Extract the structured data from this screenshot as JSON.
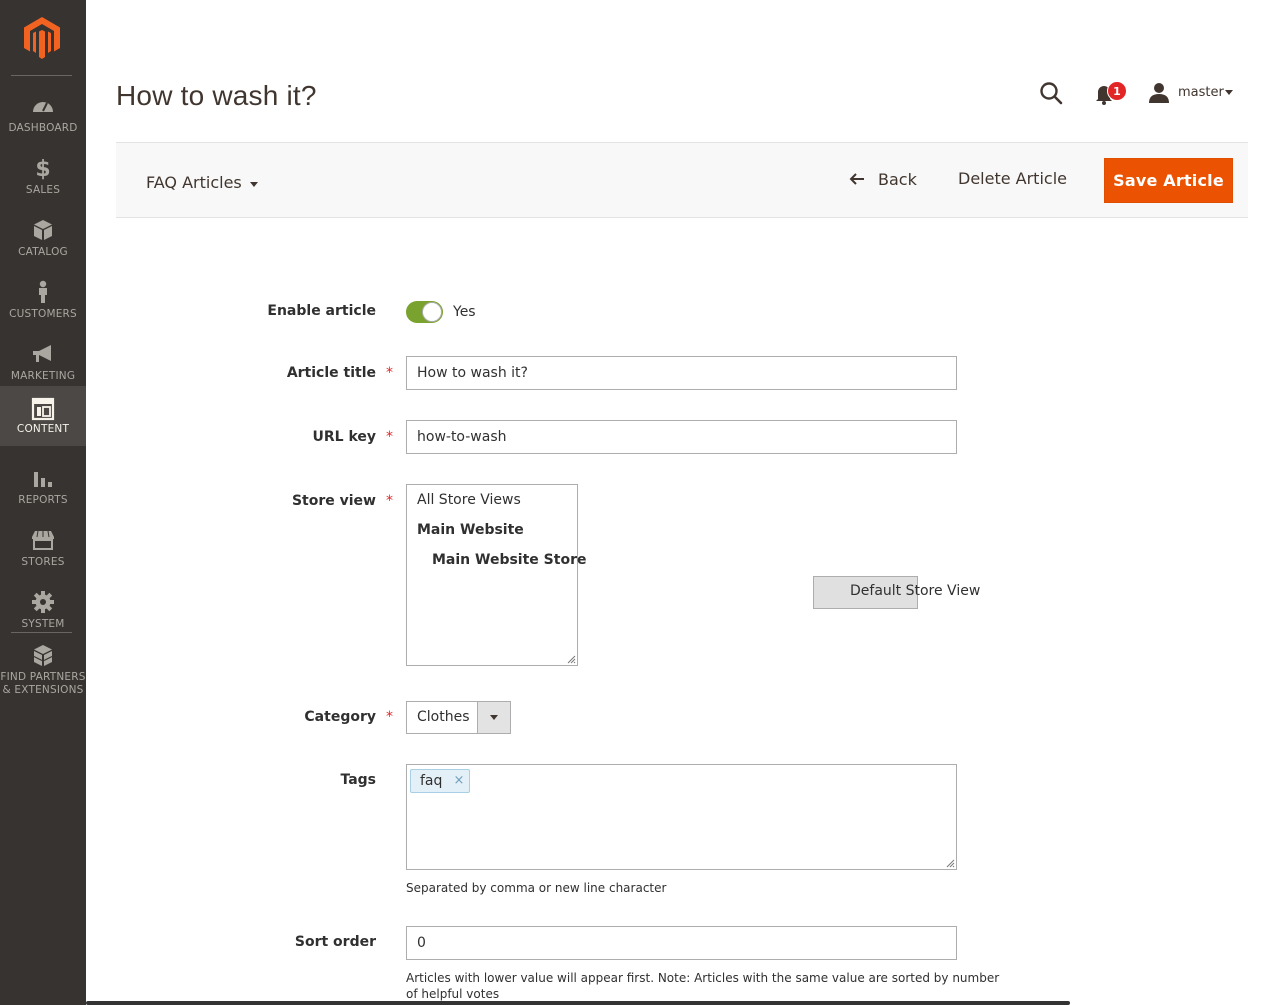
{
  "sidebar": {
    "items": [
      {
        "label": "DASHBOARD",
        "icon": "dashboard-icon"
      },
      {
        "label": "SALES",
        "icon": "dollar-icon"
      },
      {
        "label": "CATALOG",
        "icon": "cube-icon"
      },
      {
        "label": "CUSTOMERS",
        "icon": "person-icon"
      },
      {
        "label": "MARKETING",
        "icon": "megaphone-icon"
      },
      {
        "label": "CONTENT",
        "icon": "layout-icon",
        "active": true
      },
      {
        "label": "REPORTS",
        "icon": "bar-chart-icon"
      },
      {
        "label": "STORES",
        "icon": "storefront-icon"
      },
      {
        "label": "SYSTEM",
        "icon": "gear-icon"
      },
      {
        "label_line1": "FIND PARTNERS",
        "label_line2": "& EXTENSIONS",
        "icon": "boxes-icon"
      }
    ]
  },
  "header": {
    "title": "How to wash it?",
    "notifications_count": "1",
    "username": "master"
  },
  "actions": {
    "switcher_label": "FAQ Articles",
    "back_label": "Back",
    "delete_label": "Delete Article",
    "save_label": "Save Article"
  },
  "form": {
    "enable": {
      "label": "Enable article",
      "value": "Yes",
      "on": true
    },
    "title": {
      "label": "Article title",
      "value": "How to wash it?"
    },
    "url_key": {
      "label": "URL key",
      "value": "how-to-wash"
    },
    "store_view": {
      "label": "Store view",
      "options": [
        "All Store Views",
        "Main Website",
        "Main Website Store",
        "Default Store View"
      ],
      "selected": "Default Store View"
    },
    "category": {
      "label": "Category",
      "value": "Clothes"
    },
    "tags": {
      "label": "Tags",
      "values": [
        "faq"
      ],
      "note": "Separated by comma or new line character"
    },
    "sort_order": {
      "label": "Sort order",
      "value": "0",
      "note_line1": "Articles with lower value will appear first. Note: Articles with the same value are sorted by number",
      "note_line2": "of helpful votes"
    }
  },
  "colors": {
    "sidebar_bg": "#373330",
    "sidebar_active_bg": "#4b4845",
    "brand_orange": "#eb5202",
    "toggle_green": "#79a22e",
    "required_red": "#e22626"
  }
}
